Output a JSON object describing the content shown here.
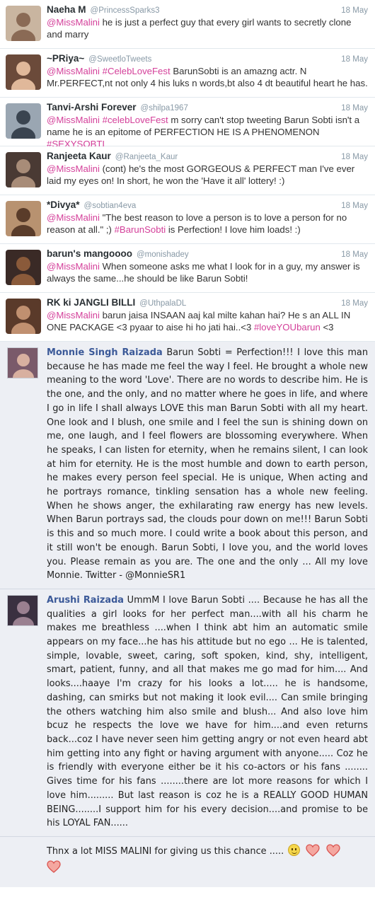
{
  "tweets": [
    {
      "name": "Naeha M",
      "handle": "@PrincessSparks3",
      "date": "18 May",
      "parts": [
        {
          "t": "@MissMalini",
          "k": "mention"
        },
        {
          "t": " he is just a perfect guy that every girl wants to secretly clone and marry",
          "k": "text"
        }
      ]
    },
    {
      "name": "~PRiya~",
      "handle": "@SweetloTweets",
      "date": "18 May",
      "parts": [
        {
          "t": "@MissMalini",
          "k": "mention"
        },
        {
          "t": " ",
          "k": "text"
        },
        {
          "t": "#CelebLoveFest",
          "k": "hash"
        },
        {
          "t": " BarunSobti is an amazng actr. N Mr.PERFECT,nt not only 4 his luks n words,bt also 4 dt beautiful heart he has.",
          "k": "text"
        }
      ]
    },
    {
      "name": "Tanvi-Arshi Forever",
      "handle": "@shilpa1967",
      "date": "18 May",
      "parts": [
        {
          "t": "@MissMalini",
          "k": "mention"
        },
        {
          "t": " ",
          "k": "text"
        },
        {
          "t": "#celebLoveFest",
          "k": "hash"
        },
        {
          "t": " m sorry can't stop tweeting Barun Sobti isn't a name he is an epitome of PERFECTION HE IS A PHENOMENON ",
          "k": "text"
        },
        {
          "t": "#SEXYSOBTI",
          "k": "hash"
        }
      ]
    },
    {
      "name": "Ranjeeta Kaur",
      "handle": "@Ranjeeta_Kaur",
      "date": "18 May",
      "parts": [
        {
          "t": "@MissMalini",
          "k": "mention"
        },
        {
          "t": " (cont) he's the most GORGEOUS & PERFECT man I've ever laid my eyes on! In short, he won the 'Have it all' lottery! :)",
          "k": "text"
        }
      ]
    },
    {
      "name": "*Divya*",
      "handle": "@sobtian4eva",
      "date": "18 May",
      "parts": [
        {
          "t": "@MissMalini",
          "k": "mention"
        },
        {
          "t": " \"The best reason to love a person is to love a person for no reason at all.\" ;) ",
          "k": "text"
        },
        {
          "t": "#BarunSobti",
          "k": "hash"
        },
        {
          "t": " is Perfection! I love him loads! :)",
          "k": "text"
        }
      ]
    },
    {
      "name": "barun's mangoooo",
      "handle": "@monishadey",
      "date": "18 May",
      "parts": [
        {
          "t": "@MissMalini",
          "k": "mention"
        },
        {
          "t": " When someone asks me what I look for in a guy, my answer is always the same...he should be like Barun Sobti!",
          "k": "text"
        }
      ]
    },
    {
      "name": "RK ki JANGLI BILLI",
      "handle": "@UthpalaDL",
      "date": "18 May",
      "parts": [
        {
          "t": "@MissMalini",
          "k": "mention"
        },
        {
          "t": " barun jaisa INSAAN aaj kal milte kahan hai? He s an ALL IN ONE PACKAGE <3 pyaar to aise hi ho jati hai..<3 ",
          "k": "text"
        },
        {
          "t": "#loveYOUbarun",
          "k": "hash"
        },
        {
          "t": " <3",
          "k": "text"
        }
      ]
    }
  ],
  "fb_posts": [
    {
      "name": "Monnie Singh Raizada",
      "text": "Barun Sobti = Perfection!!! I love this man because he has made me feel the way I feel. He brought a whole new meaning to the word 'Love'. There are no words to describe him. He is the one, and the only, and no matter where he goes in life, and where I go in life I shall always LOVE this man Barun Sobti with all my heart. One look and I blush, one smile and I feel the sun is shining down on me, one laugh, and I feel flowers are blossoming everywhere. When he speaks, I can listen for eternity, when he remains silent, I can look at him for eternity. He is the most humble and down to earth person, he makes every person feel special. He is unique, When acting and he portrays romance, tinkling sensation has a whole new feeling. When he shows anger, the exhilarating raw energy has new levels. When Barun portrays sad, the clouds pour down on me!!! Barun Sobti is this and so much more. I could write a book about this person, and it still won't be enough. Barun Sobti, I love you, and the world loves you. Please remain as you are. The one and the only ... All my love Monnie. Twitter - @MonnieSR1"
    },
    {
      "name": "Arushi Raizada",
      "text": "UmmM I love Barun Sobti .... Because he has all the qualities a girl looks for her perfect man....with all his charm he makes me breathless ....when I think abt him an automatic smile appears on my face...he has his attitude but no ego ... He is talented, simple, lovable, sweet, caring, soft spoken, kind, shy, intelligent, smart, patient, funny, and all that makes me go mad for him.... And looks....haaye I'm crazy for his looks a lot..... he is handsome, dashing, can smirks but not making it look evil.... Can smile bringing the others watching him also smile and blush... And also love him bcuz he respects the love we have for him....and even returns back...coz I have never seen him getting angry or not even heard abt him getting into any fight or having argument with anyone..... Coz he is friendly with everyone either be it his co-actors or his fans ........ Gives time for his fans ........there are lot more reasons for which I love him......... But last reason is coz he is a REALLY GOOD HUMAN BEING........I support him for his every decision....and promise to be his LOYAL FAN......"
    }
  ],
  "thanks": {
    "text": "Thnx a lot MISS MALINI for giving us this chance .....",
    "icons": [
      "smile-emoji-icon",
      "heart-icon",
      "heart-icon",
      "heart-icon"
    ]
  }
}
